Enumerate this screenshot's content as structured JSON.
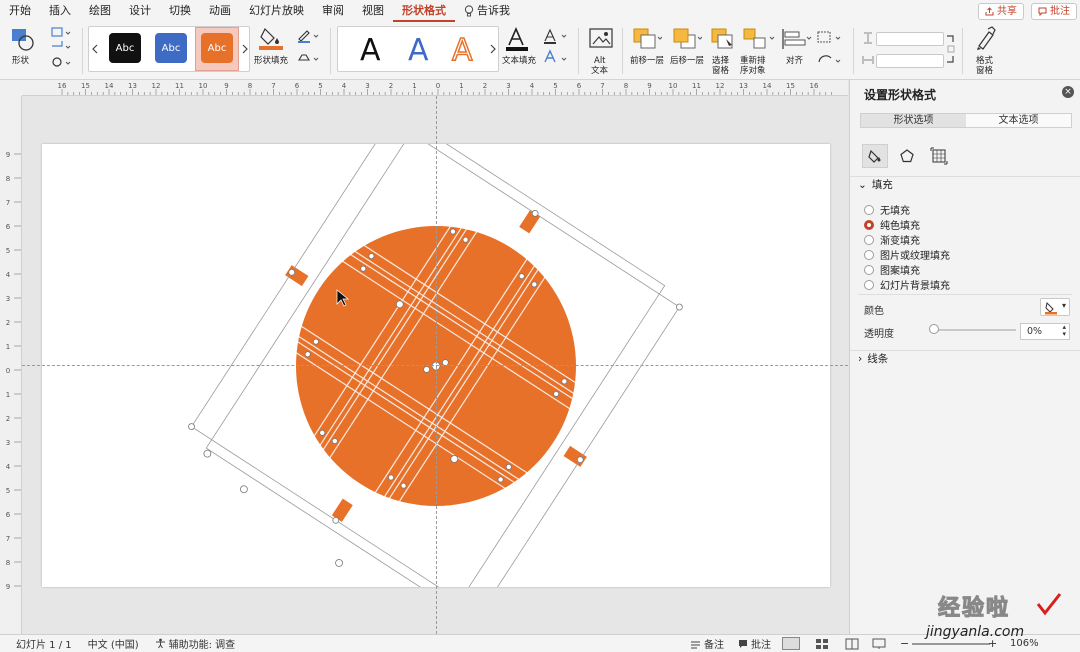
{
  "tabs": [
    "开始",
    "插入",
    "绘图",
    "设计",
    "切换",
    "动画",
    "幻灯片放映",
    "审阅",
    "视图",
    "形状格式"
  ],
  "active_tab": "形状格式",
  "tell_me": "告诉我",
  "share": "共享",
  "comments": "批注",
  "ribbon": {
    "shape_label": "形状",
    "style_samples": [
      "Abc",
      "Abc",
      "Abc"
    ],
    "shape_fill": "形状填充",
    "text_fill": "文本填充",
    "alt_text_1": "Alt",
    "alt_text_2": "文本",
    "bring_forward": "前移一层",
    "send_backward": "后移一层",
    "selection_pane_1": "选择",
    "selection_pane_2": "窗格",
    "reorder_1": "重新排",
    "reorder_2": "序对象",
    "align": "对齐",
    "format_pane_1": "格式",
    "format_pane_2": "窗格",
    "wordart_sample": "A"
  },
  "ruler_ticks_h": [
    "16",
    "15",
    "14",
    "13",
    "12",
    "11",
    "10",
    "9",
    "8",
    "7",
    "6",
    "5",
    "4",
    "3",
    "2",
    "1",
    "0",
    "1",
    "2",
    "3",
    "4",
    "5",
    "6",
    "7",
    "8",
    "9",
    "10",
    "11",
    "12",
    "13",
    "14",
    "15",
    "16"
  ],
  "ruler_ticks_v": [
    "9",
    "8",
    "7",
    "6",
    "5",
    "4",
    "3",
    "2",
    "1",
    "0",
    "1",
    "2",
    "3",
    "4",
    "5",
    "6",
    "7",
    "8",
    "9"
  ],
  "pane": {
    "title": "设置形状格式",
    "tab_shape": "形状选项",
    "tab_text": "文本选项",
    "fill_header": "填充",
    "fill_options": [
      "无填充",
      "纯色填充",
      "渐变填充",
      "图片或纹理填充",
      "图案填充",
      "幻灯片背景填充"
    ],
    "selected_fill": "纯色填充",
    "color_label": "颜色",
    "transparency_label": "透明度",
    "transparency_value": "0%",
    "line_header": "线条"
  },
  "status": {
    "slide": "幻灯片 1 / 1",
    "language": "中文 (中国)",
    "accessibility": "辅助功能: 调查",
    "notes": "备注",
    "comments": "批注",
    "zoom": "106%"
  },
  "watermark": {
    "title": "经验啦",
    "url": "jingyanla.com"
  },
  "colors": {
    "accent": "#c2422a",
    "shape_orange": "#e8712a",
    "style_black": "#111111",
    "style_blue": "#3e6bc4",
    "style_orange": "#e8712a"
  }
}
